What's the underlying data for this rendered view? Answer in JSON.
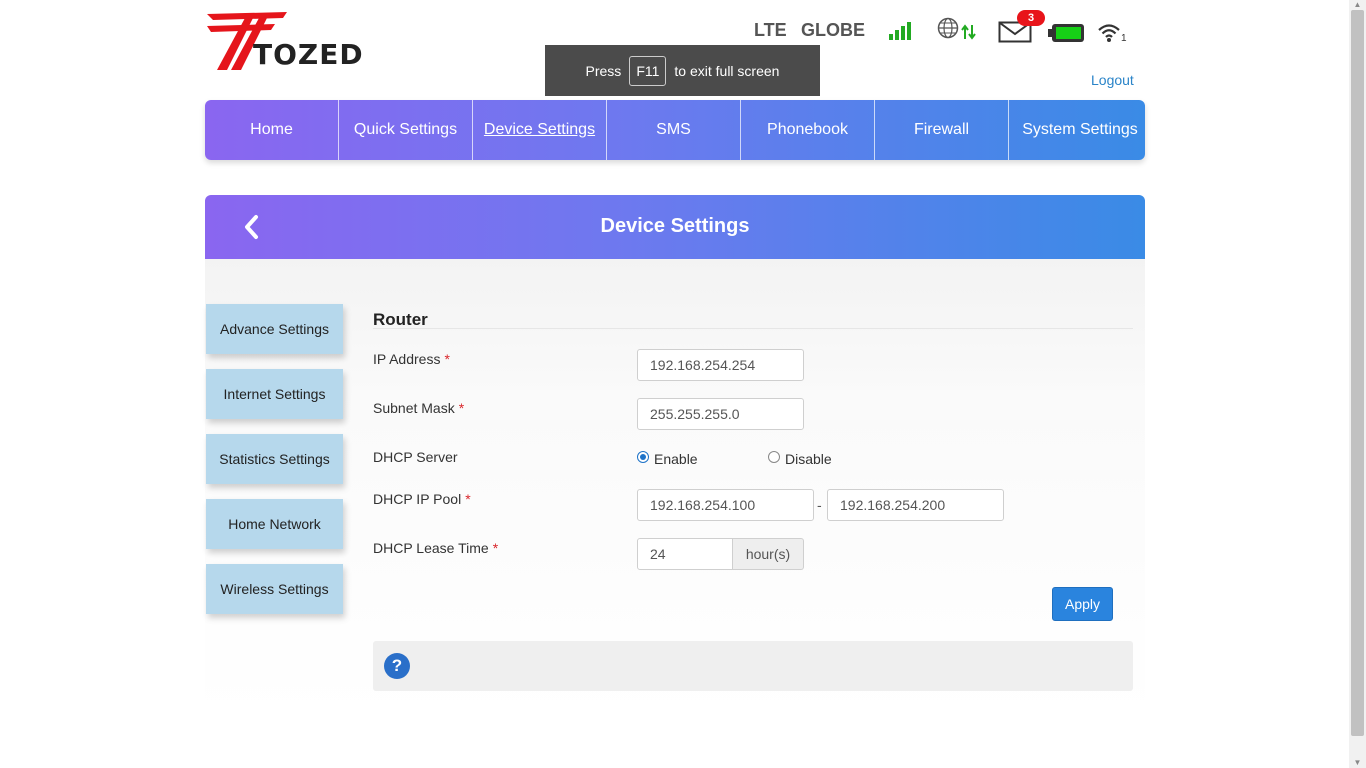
{
  "brand": {
    "name": "TOZED"
  },
  "status": {
    "network_type": "LTE",
    "operator": "GLOBE",
    "message_count": "3",
    "wifi_clients": "1",
    "icons": [
      "signal-icon",
      "globe-data-icon",
      "mail-icon",
      "battery-icon",
      "wifi-icon"
    ],
    "signal_color": "#22aa22"
  },
  "header": {
    "logout": "Logout"
  },
  "fullscreen_toast": {
    "prefix": "Press",
    "key": "F11",
    "suffix": "to exit full screen"
  },
  "nav": {
    "items": [
      {
        "label": "Home"
      },
      {
        "label": "Quick Settings"
      },
      {
        "label": "Device Settings",
        "active": true
      },
      {
        "label": "SMS"
      },
      {
        "label": "Phonebook"
      },
      {
        "label": "Firewall"
      },
      {
        "label": "System Settings"
      }
    ]
  },
  "page": {
    "title": "Device Settings"
  },
  "sidebar": {
    "items": [
      {
        "label": "Advance Settings"
      },
      {
        "label": "Internet Settings"
      },
      {
        "label": "Statistics Settings"
      },
      {
        "label": "Home Network"
      },
      {
        "label": "Wireless Settings"
      }
    ]
  },
  "form": {
    "section": "Router",
    "ip_address": {
      "label": "IP Address",
      "value": "192.168.254.254"
    },
    "subnet_mask": {
      "label": "Subnet Mask",
      "value": "255.255.255.0"
    },
    "dhcp_server": {
      "label": "DHCP Server",
      "enable": "Enable",
      "disable": "Disable",
      "selected": "Enable"
    },
    "dhcp_pool": {
      "label": "DHCP IP Pool",
      "start": "192.168.254.100",
      "separator": "-",
      "end": "192.168.254.200"
    },
    "lease_time": {
      "label": "DHCP Lease Time",
      "value": "24",
      "unit": "hour(s)"
    },
    "required_mark": "*",
    "apply": "Apply"
  },
  "help": {
    "icon": "?"
  },
  "colors": {
    "accent": "#2a84de",
    "nav_start": "#8a66f0",
    "nav_end": "#3a8be6",
    "sidebar_bg": "#b6d8ec"
  }
}
